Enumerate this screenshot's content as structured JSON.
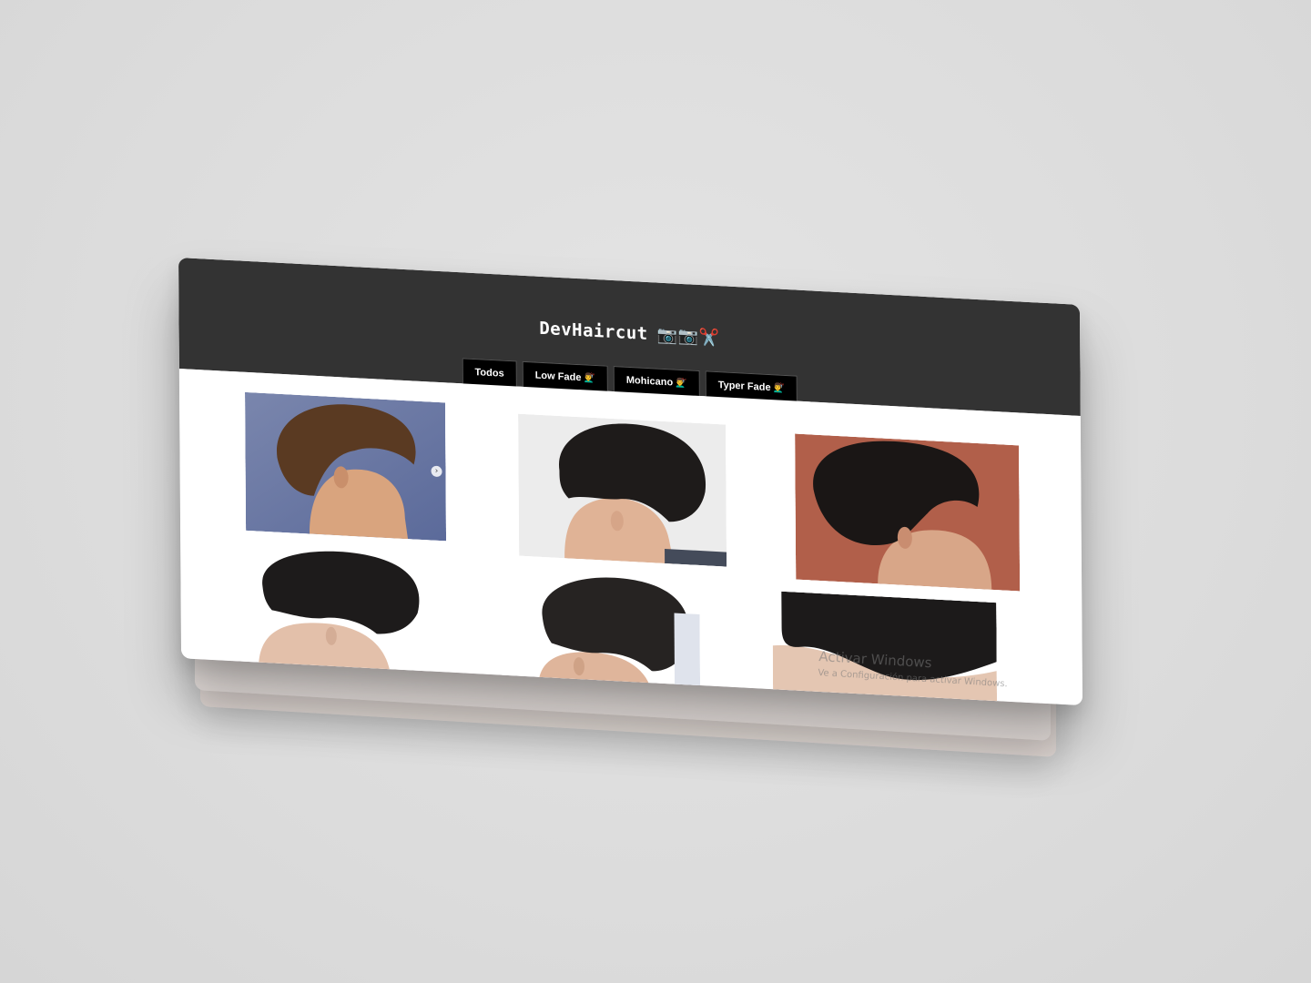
{
  "app": {
    "brand": "DevHaircut",
    "brand_icons": "📷📷✂️"
  },
  "nav": {
    "items": [
      {
        "label": "Todos",
        "emoji": ""
      },
      {
        "label": "Low Fade",
        "emoji": "💇‍♂️"
      },
      {
        "label": "Mohicano",
        "emoji": "💇‍♂️"
      },
      {
        "label": "Typer Fade",
        "emoji": "💇‍♂️"
      }
    ]
  },
  "gallery": {
    "photos": [
      {
        "name": "haircut-photo-1",
        "bg": "#6f7fa6"
      },
      {
        "name": "haircut-photo-2",
        "bg": "#e9e9e9"
      },
      {
        "name": "haircut-photo-3",
        "bg": "#b5614a"
      },
      {
        "name": "haircut-photo-4",
        "bg": "#ffffff"
      },
      {
        "name": "haircut-photo-5",
        "bg": "#ffffff"
      },
      {
        "name": "haircut-photo-6",
        "bg": "#ffffff"
      }
    ],
    "next_arrow": "›"
  },
  "watermark": {
    "title": "Activar Windows",
    "subtitle": "Ve a Configuración para activar Windows."
  },
  "colors": {
    "header_bg": "#333333",
    "button_bg": "#000000",
    "page_bg": "#dcdcdc"
  }
}
